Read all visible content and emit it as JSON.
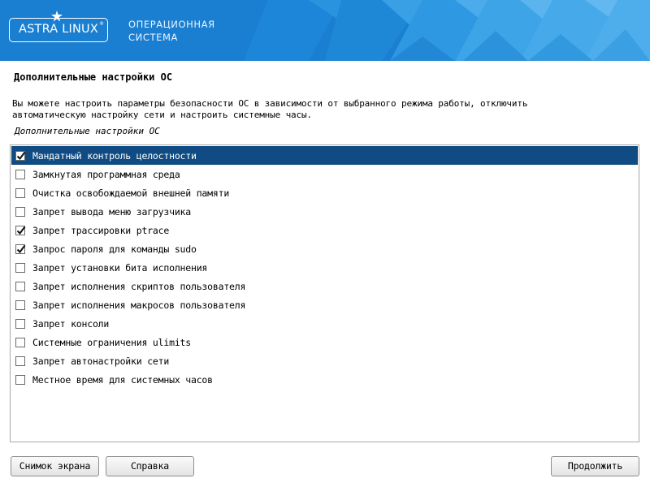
{
  "header": {
    "logo_text": "ASTRA LINUX",
    "logo_mark": "®",
    "subtitle_line1": "ОПЕРАЦИОННАЯ",
    "subtitle_line2": "СИСТЕМА",
    "background_color": "#1b7fd1"
  },
  "page": {
    "title": "Дополнительные настройки ОС",
    "description_line1": "Вы можете настроить параметры безопасности ОС в зависимости от выбранного режима работы, отключить",
    "description_line2": "автоматическую настройку сети и настроить системные часы.",
    "list_caption": "Дополнительные настройки ОС"
  },
  "options": [
    {
      "label": "Мандатный контроль целостности",
      "checked": true,
      "selected": true
    },
    {
      "label": "Замкнутая программная среда",
      "checked": false,
      "selected": false
    },
    {
      "label": "Очистка освобождаемой внешней памяти",
      "checked": false,
      "selected": false
    },
    {
      "label": "Запрет вывода меню загрузчика",
      "checked": false,
      "selected": false
    },
    {
      "label": "Запрет трассировки ptrace",
      "checked": true,
      "selected": false
    },
    {
      "label": "Запрос пароля для команды sudo",
      "checked": true,
      "selected": false
    },
    {
      "label": "Запрет установки бита исполнения",
      "checked": false,
      "selected": false
    },
    {
      "label": "Запрет исполнения скриптов пользователя",
      "checked": false,
      "selected": false
    },
    {
      "label": "Запрет исполнения макросов пользователя",
      "checked": false,
      "selected": false
    },
    {
      "label": "Запрет консоли",
      "checked": false,
      "selected": false
    },
    {
      "label": "Системные ограничения ulimits",
      "checked": false,
      "selected": false
    },
    {
      "label": "Запрет автонастройки сети",
      "checked": false,
      "selected": false
    },
    {
      "label": "Местное время для системных часов",
      "checked": false,
      "selected": false
    }
  ],
  "buttons": {
    "screenshot": "Снимок экрана",
    "help": "Справка",
    "continue": "Продолжить"
  },
  "colors": {
    "selection": "#104c83",
    "header": "#1b7fd1"
  }
}
